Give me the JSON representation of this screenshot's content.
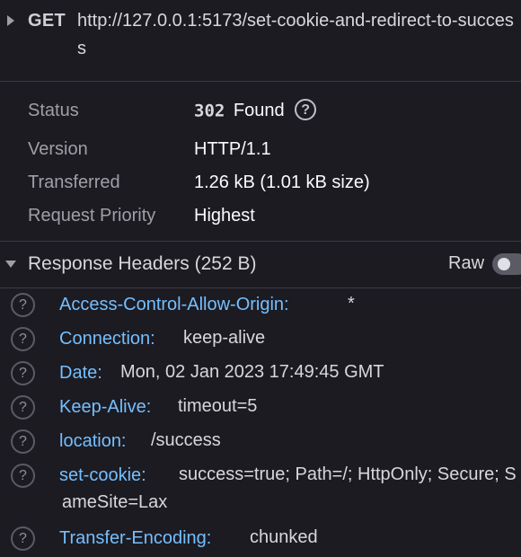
{
  "request": {
    "method": "GET",
    "url": "http://127.0.0.1:5173/set-cookie-and-redirect-to-success"
  },
  "summary": {
    "status_label": "Status",
    "status_code": "302",
    "status_text": "Found",
    "help_glyph": "?",
    "version_label": "Version",
    "version_value": "HTTP/1.1",
    "transferred_label": "Transferred",
    "transferred_value": "1.26 kB (1.01 kB size)",
    "priority_label": "Request Priority",
    "priority_value": "Highest"
  },
  "response_headers": {
    "title": "Response Headers (252 B)",
    "raw_label": "Raw",
    "raw_enabled": false,
    "items": [
      {
        "name": "Access-Control-Allow-Origin:",
        "value": "*"
      },
      {
        "name": "Connection:",
        "value": "keep-alive"
      },
      {
        "name": "Date:",
        "value": "Mon, 02 Jan 2023 17:49:45 GMT"
      },
      {
        "name": "Keep-Alive:",
        "value": "timeout=5"
      },
      {
        "name": "location:",
        "value": "/success"
      },
      {
        "name": "set-cookie:",
        "value": "success=true; Path=/; HttpOnly; Secure; SameSite=Lax"
      },
      {
        "name": "Transfer-Encoding:",
        "value": "chunked"
      }
    ]
  },
  "colors": {
    "background": "#1c1b22",
    "header_name": "#75bfff",
    "label": "#9f9fa6"
  }
}
